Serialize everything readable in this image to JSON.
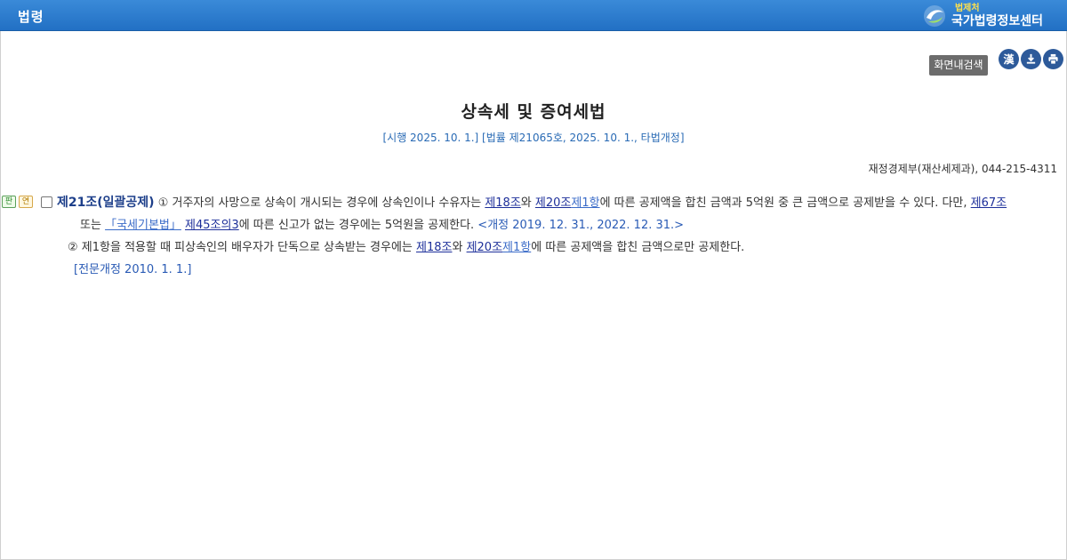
{
  "header": {
    "title": "법령",
    "brand_small": "법제처",
    "brand_big": "국가법령정보센터"
  },
  "toolbar": {
    "search_label": "화면내검색",
    "hanja_label": "漢",
    "download_icon": "download-icon",
    "print_icon": "print-icon"
  },
  "law": {
    "title": "상속세 및 증여세법",
    "subtitle": "[시행 2025. 10. 1.] [법률 제21065호, 2025. 10. 1., 타법개정]",
    "ministry": "재정경제부(재산세제과), 044-215-4311"
  },
  "article": {
    "tags": [
      "판",
      "연"
    ],
    "title": "제21조(일괄공제)",
    "p1_a": " ① 거주자의 사망으로 상속이 개시되는 경우에 상속인이나 수유자는 ",
    "ref_18": "제18조",
    "and1": "와 ",
    "ref_20": "제20조",
    "ref_20_1": "제1항",
    "p1_b": "에 따른 공제액을 합친 금액과 5억원 중 큰 금액으로 공제받을 수 있다. 다만, ",
    "ref_67": "제67조",
    "p1_c": "또는 ",
    "ref_basic": "「국세기본법」",
    "ref_45": "제45조의3",
    "p1_d": "에 따른 신고가 없는 경우에는 5억원을 공제한다.  ",
    "p1_amend": "<개정 2019. 12. 31., 2022. 12. 31.>",
    "p2_a": "② 제1항을 적용할 때 피상속인의 배우자가 단독으로 상속받는 경우에는 ",
    "p2_b": "에 따른 공제액을 합친 금액으로만 공제한다.",
    "full_amend": "[전문개정 2010. 1. 1.]"
  }
}
